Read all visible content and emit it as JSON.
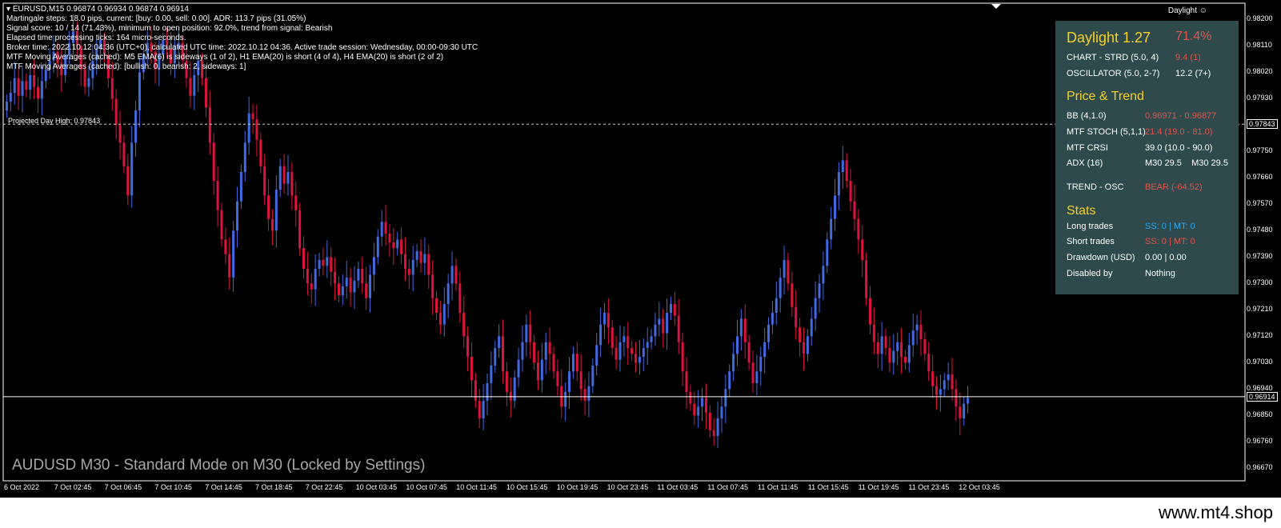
{
  "header": {
    "symbol": "EURUSD,M15",
    "ohlc": "0.96874 0.96934 0.96874 0.96914",
    "lines": [
      "Martingale steps: 18.0 pips, current: [buy: 0.00, sell: 0.00]. ADR: 113.7 pips (31.05%)",
      "Signal score: 10 / 14 (71.43%), minimum to open position: 92.0%, trend from signal: Bearish",
      "Elapsed time processing ticks: 164 micro-seconds.",
      "Broker time: 2022.10.12 04:36 (UTC+0), calculated UTC time: 2022.10.12 04:36. Active trade session: Wednesday, 00:00-09:30 UTC",
      "MTF Moving Averages (cached): M5 EMA(6) is sideways (1 of 2), H1 EMA(20) is short (4 of 4), H4 EMA(20) is short (2 of 2)",
      "MTF Moving Averages (cached): [bullish: 0, bearish: 2, sideways: 1]"
    ]
  },
  "indicator_label": "Daylight",
  "indicator_icon": "smiley-icon",
  "daylight": {
    "title": "Daylight 1.27",
    "score": "71.4%",
    "rows_top": [
      {
        "label": "CHART - STRD (5.0, 4)",
        "value": "9.4 (1)",
        "color": "red"
      },
      {
        "label": "OSCILLATOR (5.0, 2-7)",
        "value": "12.2 (7+)",
        "color": "white"
      }
    ],
    "price_trend_title": "Price & Trend",
    "rows_mid": [
      {
        "label": "BB (4,1.0)",
        "value": "0.96971 - 0.96877",
        "color": "red"
      },
      {
        "label": "MTF STOCH (5,1,1)",
        "value": "21.4 (19.0 - 81.0)",
        "color": "red"
      },
      {
        "label": "MTF CRSI",
        "value": "39.0 (10.0 - 90.0)",
        "color": "white"
      },
      {
        "label": "ADX (16)",
        "value": "M30 29.5    M30 29.5",
        "color": "white"
      },
      {
        "label": "TREND - OSC",
        "value": "BEAR (-64.52)",
        "color": "red"
      }
    ],
    "stats_title": "Stats",
    "rows_stats": [
      {
        "label": "Long trades",
        "value": "SS: 0 | MT: 0",
        "color": "blue"
      },
      {
        "label": "Short trades",
        "value": "SS: 0 | MT: 0",
        "color": "red"
      },
      {
        "label": "Drawdown (USD)",
        "value": "0.00 | 0.00",
        "color": "white"
      },
      {
        "label": "Disabled by",
        "value": "Nothing",
        "color": "white"
      }
    ]
  },
  "projected_high_label": "Projected Day High: 0.97843",
  "watermark": "AUDUSD M30 - Standard Mode on M30 (Locked by Settings)",
  "footer_url": "www.mt4.shop",
  "price_axis": [
    "0.98200",
    "0.98110",
    "0.98020",
    "0.97930",
    "0.97843",
    "0.97750",
    "0.97660",
    "0.97570",
    "0.97480",
    "0.97390",
    "0.97300",
    "0.97210",
    "0.97120",
    "0.97030",
    "0.96940",
    "0.96914",
    "0.96850",
    "0.96760",
    "0.96670"
  ],
  "current_price": "0.96914",
  "projected_price": "0.97843",
  "time_axis": [
    "6 Oct 2022",
    "7 Oct 02:45",
    "7 Oct 06:45",
    "7 Oct 10:45",
    "7 Oct 14:45",
    "7 Oct 18:45",
    "7 Oct 22:45",
    "10 Oct 03:45",
    "10 Oct 07:45",
    "10 Oct 11:45",
    "10 Oct 15:45",
    "10 Oct 19:45",
    "10 Oct 23:45",
    "11 Oct 03:45",
    "11 Oct 07:45",
    "11 Oct 11:45",
    "11 Oct 15:45",
    "11 Oct 19:45",
    "11 Oct 23:45",
    "12 Oct 03:45"
  ],
  "colors": {
    "bull": "#4169e1",
    "bear": "#dc143c",
    "panel": "#2e4a4c",
    "yellow": "#f6d11f",
    "red": "#e0554a",
    "blue": "#2fa8ef"
  },
  "chart_data": {
    "type": "candlestick",
    "ylim": [
      0.9663,
      0.9825
    ],
    "closes": [
      0.9792,
      0.9795,
      0.98,
      0.9794,
      0.9799,
      0.9796,
      0.9801,
      0.9797,
      0.9793,
      0.9799,
      0.9803,
      0.9806,
      0.9809,
      0.9805,
      0.9801,
      0.9808,
      0.9812,
      0.9816,
      0.9811,
      0.9803,
      0.9797,
      0.98,
      0.9806,
      0.981,
      0.9813,
      0.9808,
      0.98,
      0.9793,
      0.9784,
      0.9778,
      0.977,
      0.976,
      0.9778,
      0.9789,
      0.9802,
      0.9808,
      0.9812,
      0.9809,
      0.9803,
      0.9808,
      0.9813,
      0.981,
      0.9805,
      0.981,
      0.9812,
      0.9806,
      0.98,
      0.9794,
      0.9801,
      0.9806,
      0.98,
      0.979,
      0.9778,
      0.9765,
      0.9755,
      0.9745,
      0.974,
      0.9732,
      0.9748,
      0.9758,
      0.9768,
      0.9778,
      0.9788,
      0.9786,
      0.9779,
      0.977,
      0.976,
      0.9752,
      0.9748,
      0.9762,
      0.977,
      0.9764,
      0.9768,
      0.976,
      0.9755,
      0.9742,
      0.9735,
      0.973,
      0.9728,
      0.9735,
      0.9738,
      0.9736,
      0.9739,
      0.9734,
      0.973,
      0.9726,
      0.9729,
      0.9732,
      0.9727,
      0.9731,
      0.9735,
      0.973,
      0.9725,
      0.9733,
      0.9739,
      0.9746,
      0.9751,
      0.9747,
      0.9744,
      0.9742,
      0.9745,
      0.974,
      0.9735,
      0.9733,
      0.9738,
      0.9741,
      0.9737,
      0.974,
      0.9733,
      0.9725,
      0.972,
      0.9716,
      0.9723,
      0.973,
      0.9736,
      0.973,
      0.972,
      0.9712,
      0.9705,
      0.9697,
      0.969,
      0.9684,
      0.969,
      0.9696,
      0.9702,
      0.9708,
      0.9712,
      0.97,
      0.9693,
      0.969,
      0.9698,
      0.9704,
      0.971,
      0.9716,
      0.971,
      0.9703,
      0.9697,
      0.9704,
      0.971,
      0.9706,
      0.97,
      0.9695,
      0.9688,
      0.9693,
      0.97,
      0.9706,
      0.97,
      0.9694,
      0.969,
      0.9695,
      0.9702,
      0.9709,
      0.9716,
      0.972,
      0.9715,
      0.9708,
      0.9704,
      0.971,
      0.9712,
      0.9708,
      0.9706,
      0.9703,
      0.9705,
      0.9708,
      0.971,
      0.9712,
      0.9716,
      0.9718,
      0.9713,
      0.972,
      0.9723,
      0.9719,
      0.971,
      0.97,
      0.9693,
      0.9689,
      0.9685,
      0.9688,
      0.9691,
      0.9686,
      0.968,
      0.9678,
      0.9684,
      0.9688,
      0.9694,
      0.97,
      0.9706,
      0.9712,
      0.9718,
      0.971,
      0.9703,
      0.9696,
      0.97,
      0.9705,
      0.971,
      0.9716,
      0.972,
      0.9725,
      0.9732,
      0.9738,
      0.973,
      0.9722,
      0.9715,
      0.971,
      0.9706,
      0.9712,
      0.9718,
      0.9725,
      0.973,
      0.9736,
      0.9745,
      0.9752,
      0.976,
      0.9768,
      0.9772,
      0.9765,
      0.9758,
      0.9752,
      0.9745,
      0.9738,
      0.9725,
      0.9716,
      0.971,
      0.9706,
      0.9712,
      0.9708,
      0.9703,
      0.9707,
      0.971,
      0.9705,
      0.9703,
      0.9709,
      0.9714,
      0.9716,
      0.9711,
      0.9706,
      0.97,
      0.9695,
      0.9692,
      0.9694,
      0.9697,
      0.9699,
      0.9694,
      0.9688,
      0.9684,
      0.9689,
      0.9691
    ]
  }
}
